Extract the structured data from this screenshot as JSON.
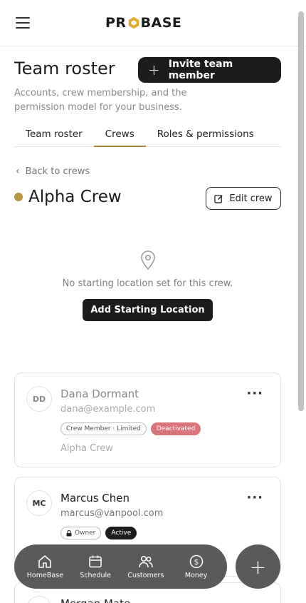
{
  "header": {
    "logo_text_left": "PR",
    "logo_text_right": "BASE"
  },
  "page": {
    "title": "Team roster",
    "invite_label": "Invite team member",
    "subtitle": "Accounts, crew membership, and the permission model for your business."
  },
  "tabs": [
    {
      "label": "Team roster",
      "active": false
    },
    {
      "label": "Crews",
      "active": true
    },
    {
      "label": "Roles & permissions",
      "active": false
    }
  ],
  "crew": {
    "back_label": "Back to crews",
    "name": "Alpha Crew",
    "edit_label": "Edit crew",
    "empty_message": "No starting location set for this crew.",
    "add_location_label": "Add Starting Location"
  },
  "members": [
    {
      "initials": "DD",
      "name": "Dana Dormant",
      "email": "dana@example.com",
      "badges": [
        "Crew Member · Limited",
        "Deactivated"
      ],
      "crew": "Alpha Crew"
    },
    {
      "initials": "MC",
      "name": "Marcus Chen",
      "email": "marcus@vanpool.com",
      "badges": [
        "Owner",
        "Active"
      ]
    },
    {
      "name": "Morgan Mate"
    }
  ],
  "bottom_nav": [
    {
      "label": "HomeBase",
      "icon": "home-icon"
    },
    {
      "label": "Schedule",
      "icon": "calendar-icon"
    },
    {
      "label": "Customers",
      "icon": "users-icon"
    },
    {
      "label": "Money",
      "icon": "dollar-icon"
    }
  ],
  "fab": {
    "label": "+"
  },
  "colors": {
    "accent": "#b39548",
    "dark": "#1c1c1c",
    "deactivated": "#d9747a",
    "nav_bg": "#5a5a5a"
  }
}
